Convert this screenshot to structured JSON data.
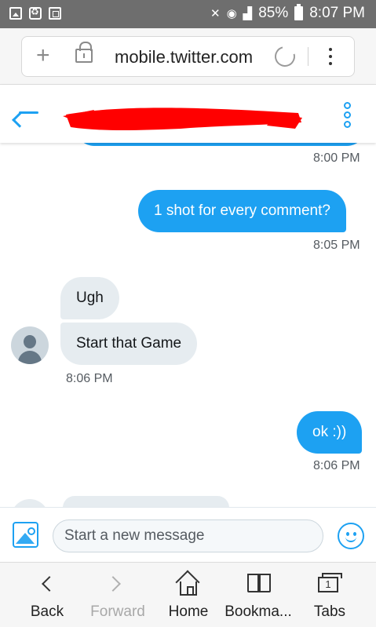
{
  "status_bar": {
    "battery": "85%",
    "time": "8:07 PM"
  },
  "browser": {
    "url": "mobile.twitter.com"
  },
  "conversation": {
    "messages": [
      {
        "direction": "out",
        "text": "1 shot for every comment?",
        "time": "8:05 PM"
      },
      {
        "direction": "in",
        "text": "Ugh"
      },
      {
        "direction": "in",
        "text": "Start that Game",
        "time": "8:06 PM"
      },
      {
        "direction": "out",
        "text": "ok :))",
        "time": "8:06 PM"
      }
    ],
    "previous_time": "8:00 PM"
  },
  "composer": {
    "placeholder": "Start a new message"
  },
  "bottom_nav": {
    "back": "Back",
    "forward": "Forward",
    "home": "Home",
    "bookmarks": "Bookma...",
    "tabs": "Tabs",
    "tabs_count": "1"
  },
  "colors": {
    "accent": "#1da1f2",
    "bubble_in": "#e6ecf0",
    "redaction": "#ff0000"
  }
}
